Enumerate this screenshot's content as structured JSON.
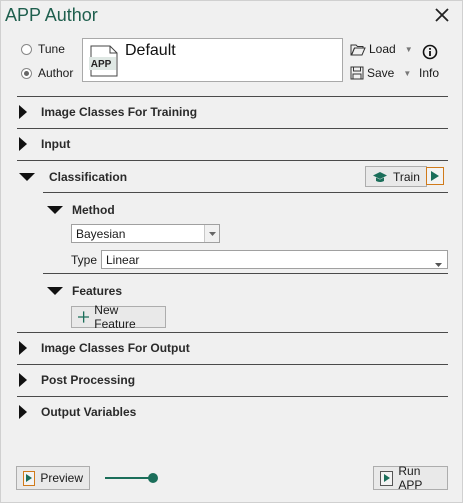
{
  "window": {
    "title": "APP Author"
  },
  "mode": {
    "tune_label": "Tune",
    "author_label": "Author",
    "selected": "Author"
  },
  "app": {
    "icon_text": "APP",
    "name": "Default"
  },
  "toolbar": {
    "load_label": "Load",
    "save_label": "Save",
    "info_label": "Info"
  },
  "sections": {
    "image_classes_training": "Image Classes For Training",
    "input": "Input",
    "classification": "Classification",
    "image_classes_output": "Image Classes For Output",
    "post_processing": "Post Processing",
    "output_variables": "Output Variables"
  },
  "classification": {
    "train_label": "Train",
    "method": {
      "label": "Method",
      "selected": "Bayesian",
      "type_label": "Type",
      "type_value": "Linear"
    },
    "features": {
      "label": "Features",
      "new_feature_label": "New Feature"
    }
  },
  "footer": {
    "preview_label": "Preview",
    "run_label": "Run APP",
    "slider_level": 1.0
  },
  "colors": {
    "accent": "#1b6e5a",
    "play_border": "#d07a1a",
    "title": "#1f5f4e"
  }
}
